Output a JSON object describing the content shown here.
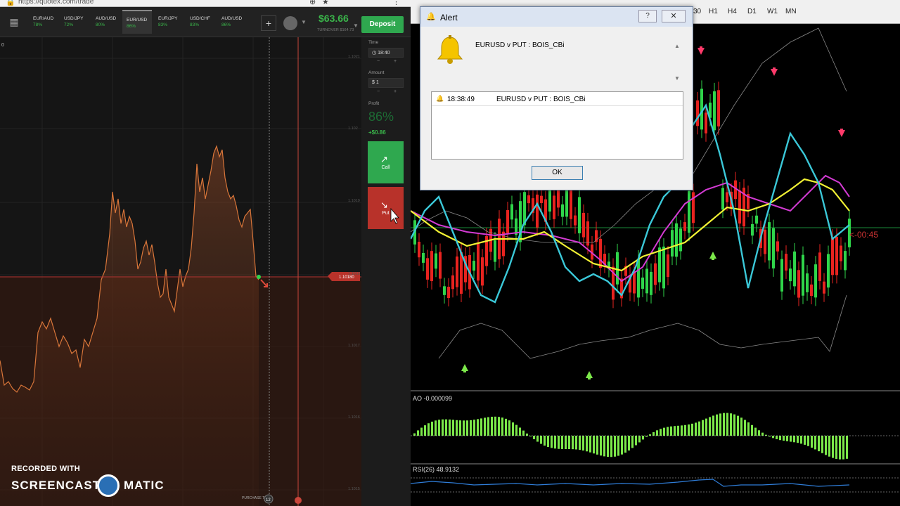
{
  "browser": {
    "url": "https://quotex.com/trade"
  },
  "assets": [
    {
      "name": "EUR/AUD",
      "pct": "78%"
    },
    {
      "name": "USD/JPY",
      "pct": "72%"
    },
    {
      "name": "AUD/USD",
      "pct": "80%"
    },
    {
      "name": "EUR/USD",
      "pct": "86%"
    },
    {
      "name": "EUR/JPY",
      "pct": "83%"
    },
    {
      "name": "USD/CHF",
      "pct": "83%"
    },
    {
      "name": "AUD/USD",
      "pct": "86%"
    }
  ],
  "header": {
    "plus": "+",
    "balance": "$63.66",
    "turnover": "TURNOVER $164.73",
    "deposit": "Deposit"
  },
  "side": {
    "time_label": "Time",
    "time_value": "18:40",
    "amount_label": "Amount",
    "amount_value": "$ 1",
    "minus": "−",
    "plus": "+",
    "profit_label": "Profit",
    "profit_pct": "86%",
    "profit_value": "+$0.86",
    "call": "Call",
    "put": "Put"
  },
  "chart": {
    "corner": "0",
    "price_tag": "1.10180",
    "purchase_label": "PURCHASE TIME",
    "purchase_value": "12",
    "axis_ticks": [
      "1.1021",
      "1.102",
      "1.1019",
      "1.1018",
      "1.1017",
      "1.1016",
      "1.1015"
    ]
  },
  "watermark": {
    "line1": "RECORDED WITH",
    "left": "SCREENCAST",
    "right": "MATIC"
  },
  "mt4": {
    "timeframes": [
      "30",
      "H1",
      "H4",
      "D1",
      "W1",
      "MN"
    ],
    "countdown": "<-00:45",
    "ao_label": "AO -0.000099",
    "rsi_label": "RSI(26) 48.9132"
  },
  "alert": {
    "title": "Alert",
    "help": "?",
    "close": "✕",
    "message": "EURUSD v PUT : BOIS_CBi",
    "log": [
      {
        "time": "18:38:49",
        "text": "EURUSD v PUT : BOIS_CBi"
      }
    ],
    "ok": "OK"
  }
}
